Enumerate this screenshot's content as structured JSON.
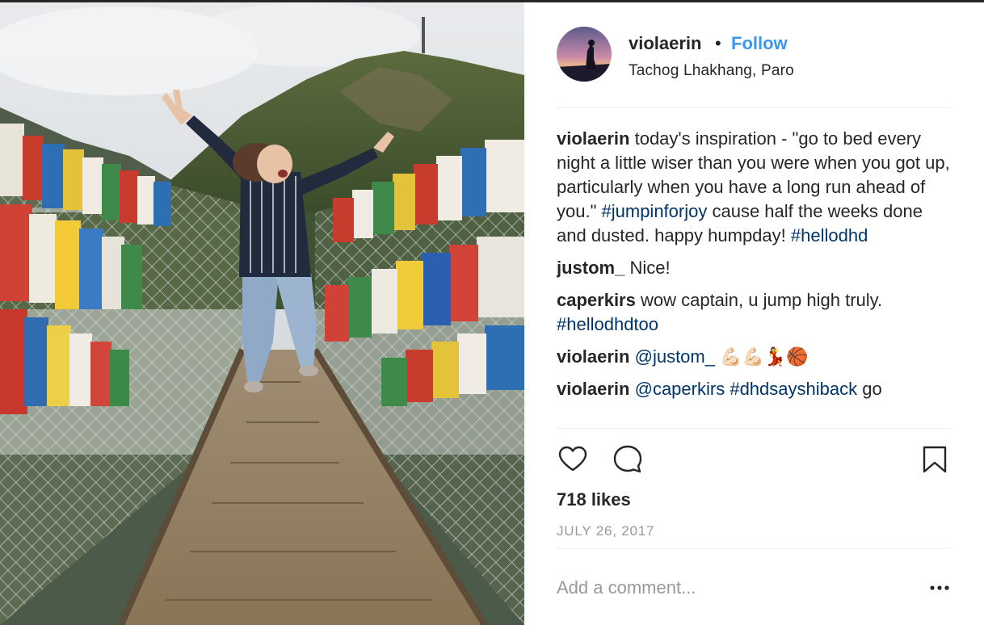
{
  "post": {
    "username": "violaerin",
    "separator": "•",
    "follow_label": "Follow",
    "location": "Tachog Lhakhang, Paro"
  },
  "comments": [
    {
      "user": "violaerin",
      "parts": [
        {
          "text": " today's inspiration - \"go to bed every night a little wiser than you were when you got up, particularly when you have a long run ahead of you.\" "
        },
        {
          "text": "#jumpinforjoy",
          "tag": true
        },
        {
          "text": " cause half the weeks done and dusted. happy humpday! "
        },
        {
          "text": "#hellodhd",
          "tag": true
        }
      ]
    },
    {
      "user": "justom_",
      "parts": [
        {
          "text": " Nice!"
        }
      ]
    },
    {
      "user": "caperkirs",
      "parts": [
        {
          "text": " wow captain, u jump high truly. "
        },
        {
          "text": "#hellodhdtoo",
          "tag": true
        }
      ]
    },
    {
      "user": "violaerin",
      "parts": [
        {
          "text": " "
        },
        {
          "text": "@justom_",
          "tag": true
        },
        {
          "text": " 💪🏻💪🏻💃🏀"
        }
      ]
    },
    {
      "user": "violaerin",
      "parts": [
        {
          "text": " "
        },
        {
          "text": "@caperkirs",
          "tag": true
        },
        {
          "text": " "
        },
        {
          "text": "#dhdsayshiback",
          "tag": true
        },
        {
          "text": " go"
        }
      ]
    }
  ],
  "likes_text": "718 likes",
  "date_text": "JULY 26, 2017",
  "comment_placeholder": "Add a comment...",
  "more_glyph": "•••",
  "icons": {
    "like": "heart-icon",
    "comment": "speech-bubble-icon",
    "save": "bookmark-icon",
    "more": "ellipsis-icon"
  },
  "colors": {
    "follow": "#3897f0",
    "hashtag": "#003569",
    "text": "#262626",
    "muted": "#999999",
    "divider": "#efefef"
  }
}
